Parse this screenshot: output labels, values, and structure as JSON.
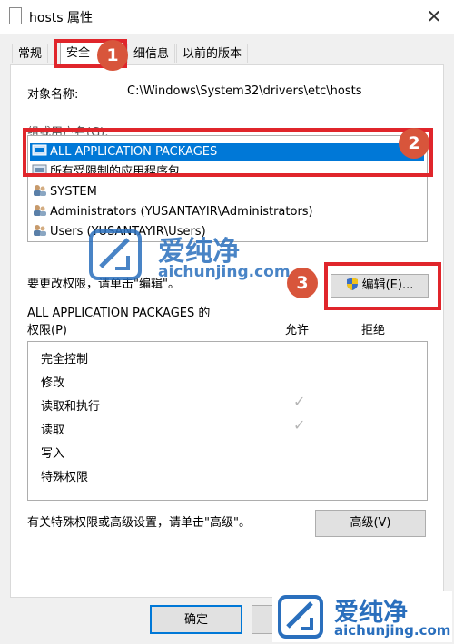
{
  "window": {
    "title": "hosts 属性",
    "close_glyph": "✕"
  },
  "tabs": [
    "常规",
    "安全",
    "细信息",
    "以前的版本"
  ],
  "object_name": {
    "label": "对象名称:",
    "value": "C:\\Windows\\System32\\drivers\\etc\\hosts"
  },
  "groups": {
    "label": "组或用户名(G):",
    "items": [
      "ALL APPLICATION PACKAGES",
      "所有受限制的应用程序包",
      "SYSTEM",
      "Administrators (YUSANTAYIR\\Administrators)",
      "Users (YUSANTAYIR\\Users)"
    ],
    "selected_index": 0
  },
  "change_hint": "要更改权限，请单击\"编辑\"。",
  "edit_button": "编辑(E)...",
  "permissions": {
    "title_line1": "ALL APPLICATION PACKAGES 的",
    "title_line2": "权限(P)",
    "allow_header": "允许",
    "deny_header": "拒绝",
    "rows": [
      {
        "name": "完全控制",
        "allow": false
      },
      {
        "name": "修改",
        "allow": false
      },
      {
        "name": "读取和执行",
        "allow": true
      },
      {
        "name": "读取",
        "allow": true
      },
      {
        "name": "写入",
        "allow": false
      },
      {
        "name": "特殊权限",
        "allow": false
      }
    ],
    "check_glyph": "✓"
  },
  "advanced_hint": "有关特殊权限或高级设置，请单击\"高级\"。",
  "advanced_button": "高级(V)",
  "ok_button": "确定",
  "badges": [
    "1",
    "2",
    "3"
  ],
  "watermark": {
    "brand": "爱纯净",
    "url": "aichunjing.com"
  },
  "colors": {
    "selection": "#0078d7",
    "annotation_red": "#e0252b",
    "badge": "#d8553b",
    "watermark": "#2a6fbd"
  }
}
